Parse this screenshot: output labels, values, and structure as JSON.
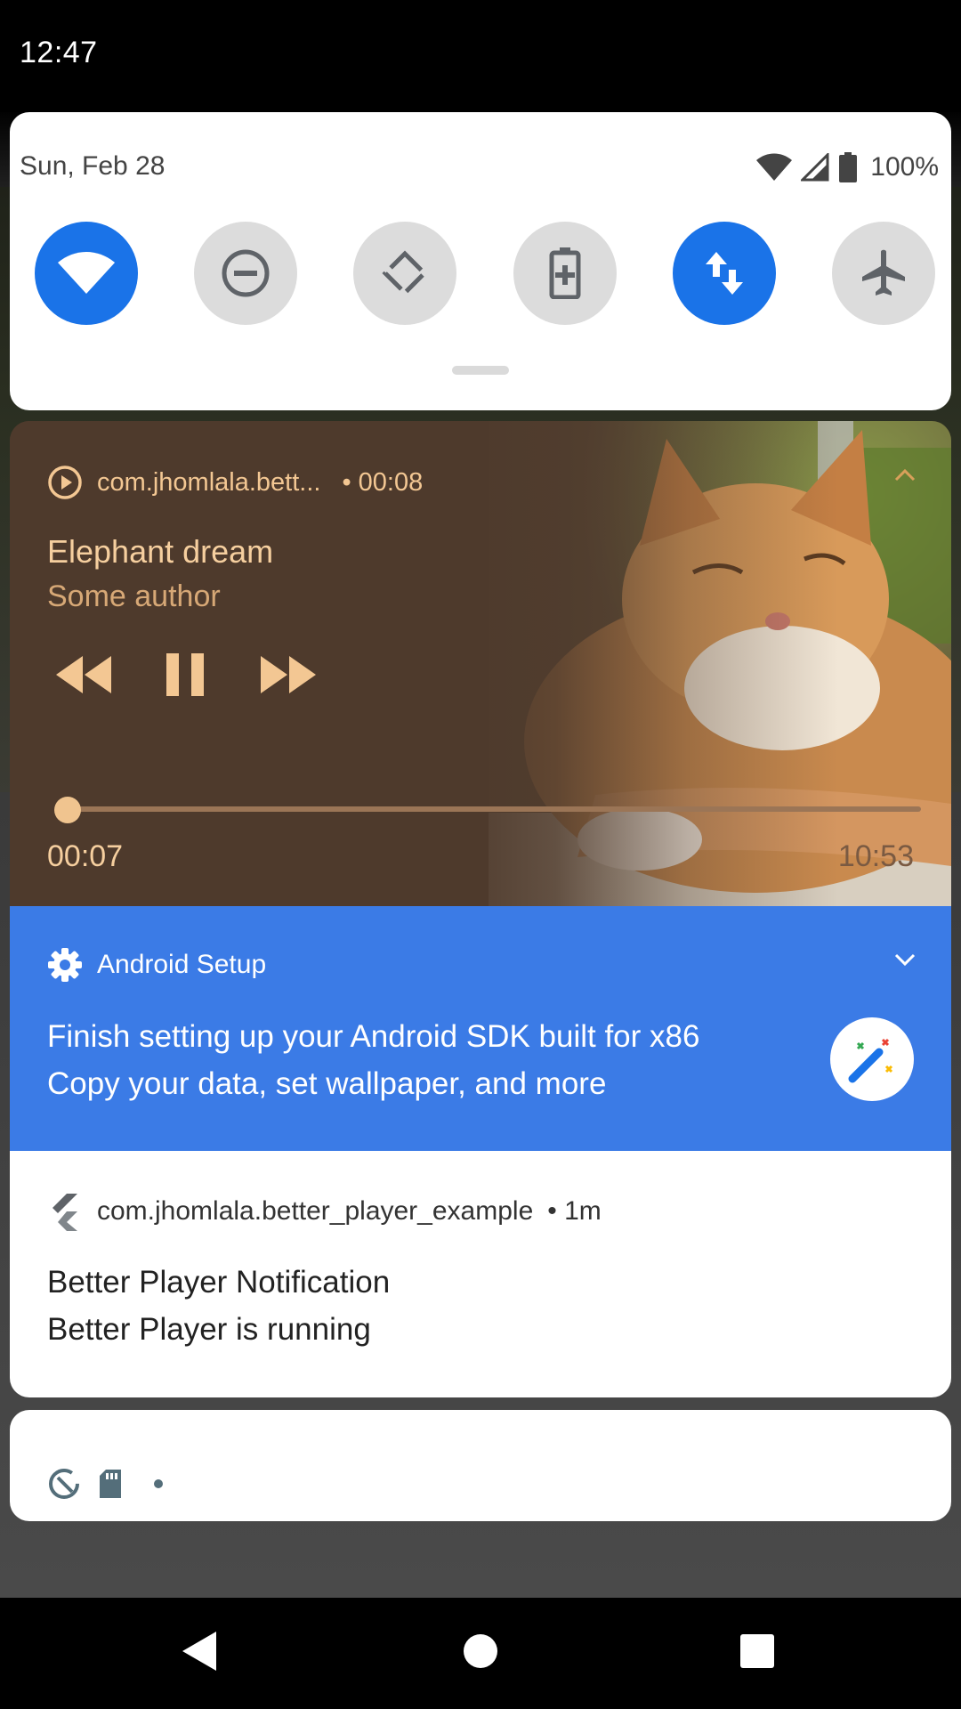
{
  "status_bar": {
    "time": "12:47"
  },
  "quick_settings": {
    "date": "Sun, Feb 28",
    "battery_percent": "100%",
    "tiles": [
      {
        "name": "wifi",
        "on": true
      },
      {
        "name": "do-not-disturb",
        "on": false
      },
      {
        "name": "auto-rotate",
        "on": false
      },
      {
        "name": "battery-saver",
        "on": false
      },
      {
        "name": "mobile-data",
        "on": true
      },
      {
        "name": "airplane-mode",
        "on": false
      }
    ]
  },
  "media_notification": {
    "app": "com.jhomlala.bett...",
    "elapsed": "• 00:08",
    "title": "Elephant dream",
    "author": "Some author",
    "position": "00:07",
    "duration": "10:53",
    "progress": 0.011,
    "accent_color": "#f6cf9f",
    "background_color": "#4e3a2c"
  },
  "setup_notification": {
    "app": "Android Setup",
    "title": "Finish setting up your Android SDK built for x86",
    "text": "Copy your data, set wallpaper, and more",
    "color": "#3b7be6"
  },
  "player_notification": {
    "app": "com.jhomlala.better_player_example",
    "time": "• 1m",
    "title": "Better Player Notification",
    "text": "Better Player is running"
  },
  "silent_shelf": {
    "icons": [
      "data-saver-icon",
      "sd-card-icon"
    ]
  },
  "nav_bar": {
    "buttons": [
      "back",
      "home",
      "recents"
    ]
  }
}
